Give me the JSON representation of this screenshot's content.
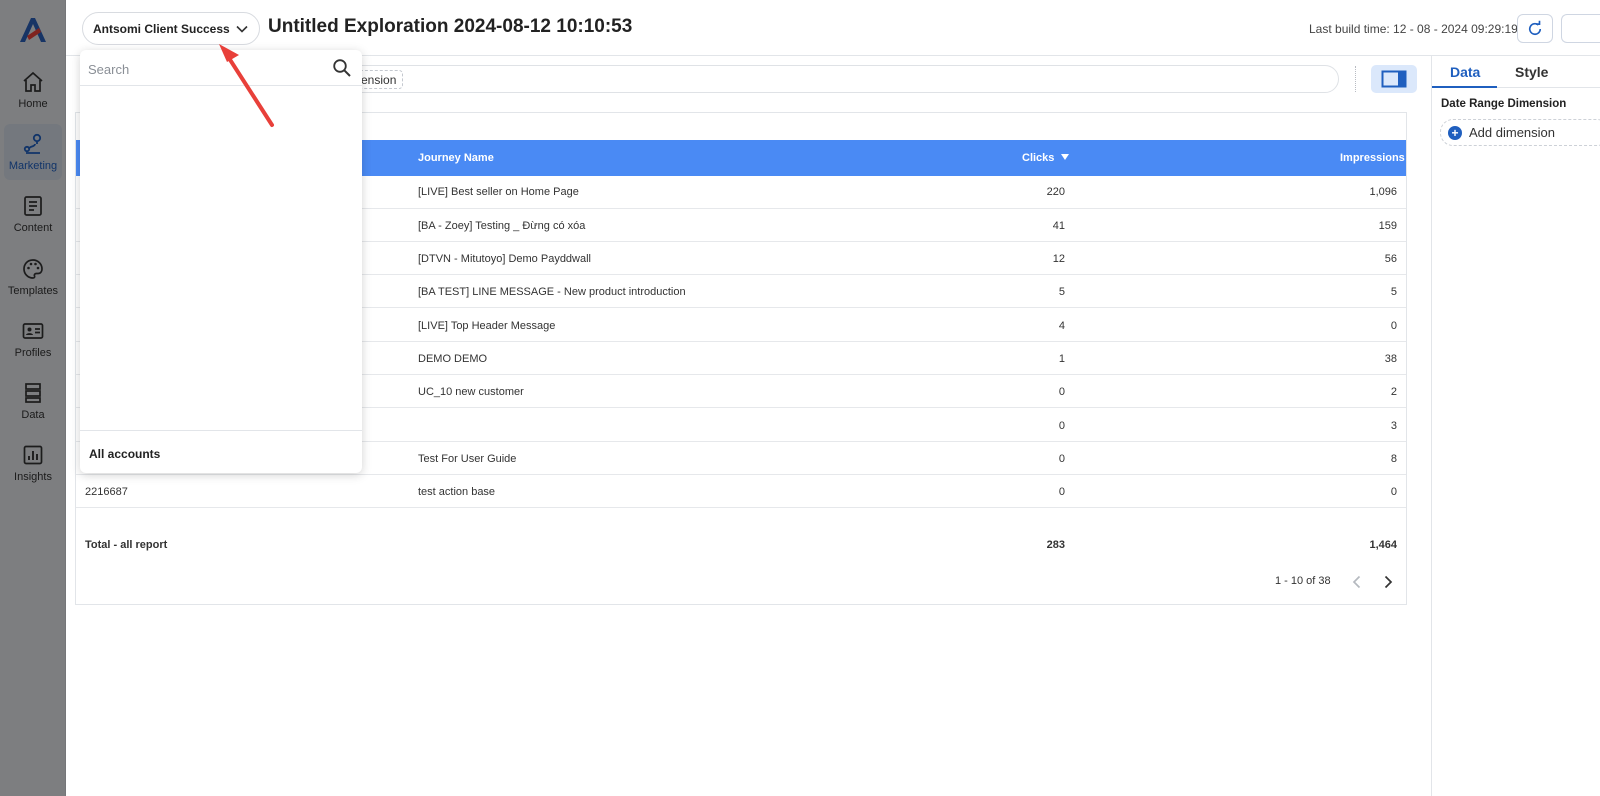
{
  "leftnav": {
    "items": [
      {
        "label": "Home",
        "icon": "home-icon"
      },
      {
        "label": "Marketing",
        "icon": "marketing-icon"
      },
      {
        "label": "Content",
        "icon": "content-icon"
      },
      {
        "label": "Templates",
        "icon": "palette-icon"
      },
      {
        "label": "Profiles",
        "icon": "profile-card-icon"
      },
      {
        "label": "Data",
        "icon": "data-stack-icon"
      },
      {
        "label": "Insights",
        "icon": "chart-icon"
      }
    ],
    "active": "Marketing"
  },
  "header": {
    "account": "Antsomi Client Success",
    "title": "Untitled Exploration 2024-08-12 10:10:53",
    "build_time": "Last build time: 12 - 08 - 2024 09:29:19"
  },
  "filter_bar": {
    "chip": "ension"
  },
  "right_panel": {
    "tabs": [
      "Data",
      "Style"
    ],
    "active_tab": "Data",
    "section_label": "Date Range Dimension",
    "add_dimension": "Add dimension"
  },
  "table": {
    "columns": [
      "Journey Name",
      "Clicks",
      "Impressions"
    ],
    "sort_column": "Clicks",
    "rows": [
      {
        "id": "",
        "name": "[LIVE] Best seller on Home Page",
        "clicks": "220",
        "impressions": "1,096"
      },
      {
        "id": "",
        "name": "[BA - Zoey] Testing _ Đừng có xóa",
        "clicks": "41",
        "impressions": "159"
      },
      {
        "id": "",
        "name": "[DTVN - Mitutoyo] Demo Payddwall",
        "clicks": "12",
        "impressions": "56"
      },
      {
        "id": "",
        "name": "[BA TEST] LINE MESSAGE - New product introduction",
        "clicks": "5",
        "impressions": "5"
      },
      {
        "id": "",
        "name": "[LIVE] Top Header Message",
        "clicks": "4",
        "impressions": "0"
      },
      {
        "id": "",
        "name": "DEMO DEMO",
        "clicks": "1",
        "impressions": "38"
      },
      {
        "id": "",
        "name": "UC_10 new customer",
        "clicks": "0",
        "impressions": "2"
      },
      {
        "id": "",
        "name": "",
        "clicks": "0",
        "impressions": "3"
      },
      {
        "id": "",
        "name": "Test For User Guide",
        "clicks": "0",
        "impressions": "8"
      },
      {
        "id": "2216687",
        "name": "test action base",
        "clicks": "0",
        "impressions": "0"
      }
    ],
    "total": {
      "label": "Total - all report",
      "clicks": "283",
      "impressions": "1,464"
    },
    "pagination": "1 - 10 of 38"
  },
  "dropdown": {
    "search_placeholder": "Search",
    "footer": "All accounts"
  },
  "colors": {
    "accent": "#1f5fbf",
    "table_header": "#4a8af4",
    "annotation_arrow": "#e8403a"
  }
}
